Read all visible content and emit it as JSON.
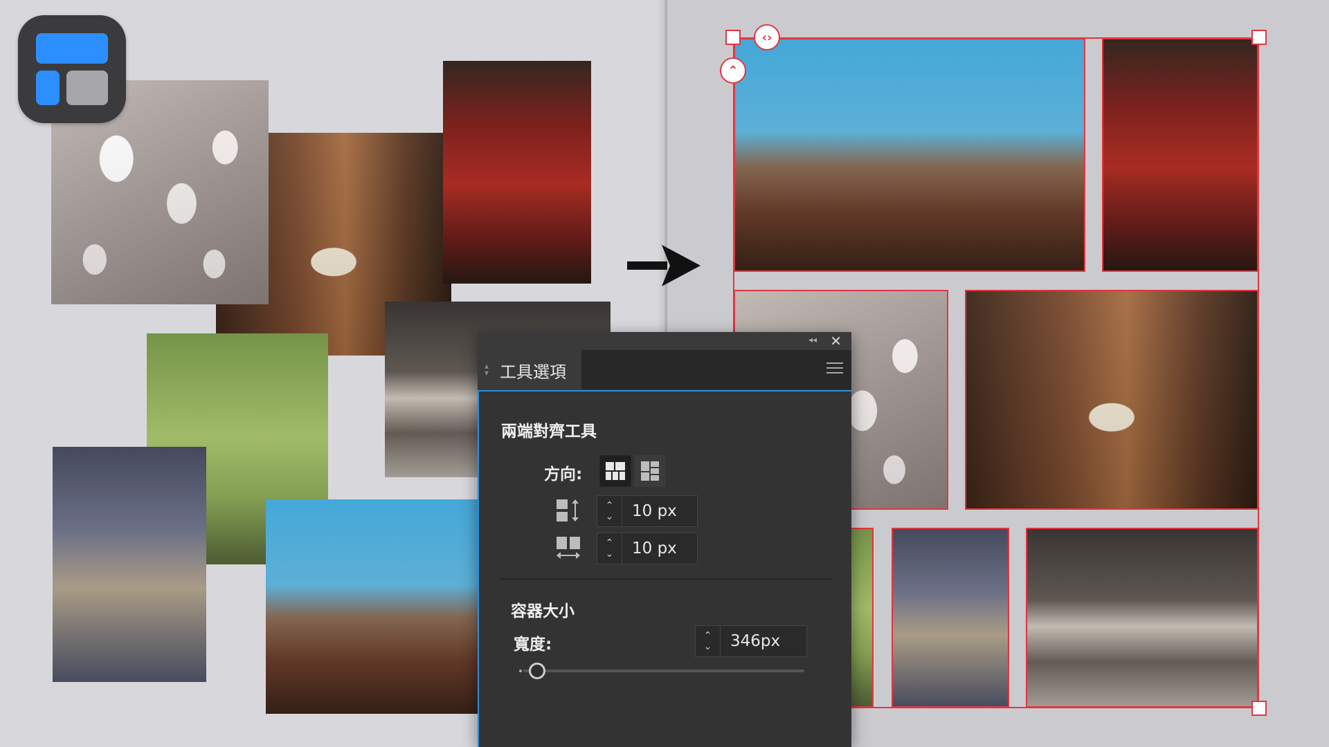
{
  "panel": {
    "tab_label": "工具選項",
    "section_title": "兩端對齊工具",
    "direction_label": "方向:",
    "spacing_vertical_value": "10 px",
    "spacing_horizontal_value": "10 px",
    "container_size_title": "容器大小",
    "width_label": "寬度:",
    "width_value": "346px",
    "width_slider_fraction": 0.05,
    "direction_options": [
      "rows-icon",
      "columns-icon"
    ],
    "direction_selected": "rows-icon"
  },
  "colors": {
    "selection": "#e3353f",
    "app_icon_blue": "#2c8fff",
    "panel_bg": "#333334",
    "panel_accent": "#2b8ee0"
  },
  "icons": {
    "app": "justified-layout-app-icon",
    "arrow": "arrow-right-icon",
    "close": "close-icon",
    "collapse": "double-chevron-left-icon",
    "menu": "hamburger-menu-icon"
  }
}
